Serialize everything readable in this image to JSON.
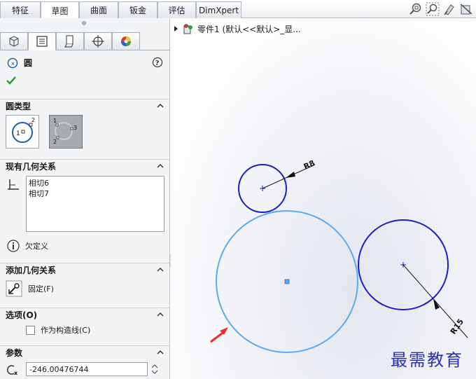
{
  "tabs": [
    {
      "label": "特征",
      "active": false
    },
    {
      "label": "草图",
      "active": true
    },
    {
      "label": "曲面",
      "active": false
    },
    {
      "label": "钣金",
      "active": false
    },
    {
      "label": "评估",
      "active": false
    },
    {
      "label": "DimXpert",
      "active": false
    }
  ],
  "feature_title": "圆",
  "sections": {
    "circle_type": {
      "title": "圆类型"
    },
    "existing_relations": {
      "title": "现有几何关系",
      "items": [
        "相切6",
        "相切7"
      ],
      "status": "欠定义"
    },
    "add_relations": {
      "title": "添加几何关系",
      "fix_label": "固定(F)"
    },
    "options": {
      "title": "选项(O)",
      "construction_label": "作为构造线(C)"
    },
    "parameters": {
      "title": "参数",
      "x_value": "-246.00476744"
    }
  },
  "tree": {
    "part_label": "零件1  (默认<<默认>_显..."
  },
  "dimensions": {
    "small": "R8",
    "large": "R15"
  },
  "watermark": "最需教育",
  "colors": {
    "accent": "#1c1ccc",
    "selected_circle": "#5aaaf0",
    "arrow": "#e8302a"
  }
}
